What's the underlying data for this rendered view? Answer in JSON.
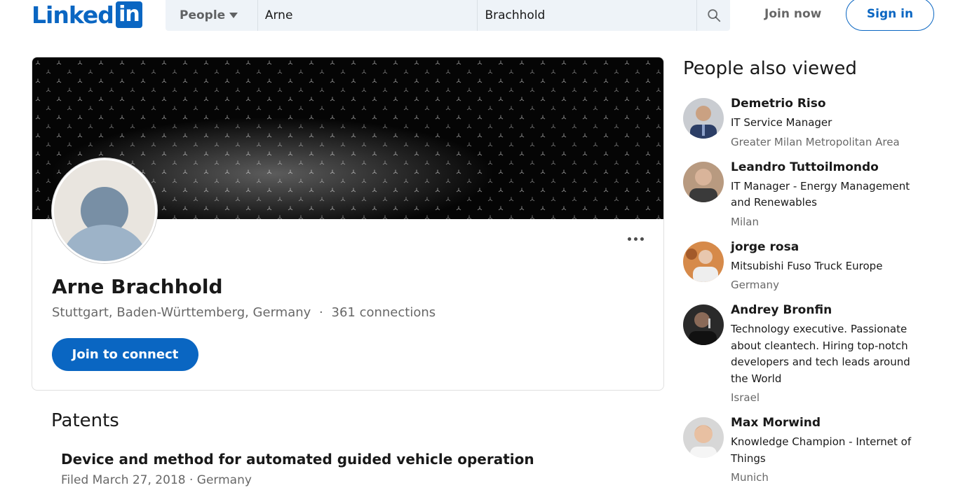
{
  "header": {
    "logo_text": "Linked",
    "logo_box_text": "in",
    "search_type_label": "People",
    "first_name_value": "Arne",
    "last_name_value": "Brachhold",
    "join_now_label": "Join now",
    "sign_in_label": "Sign in",
    "search_icon": "search-icon"
  },
  "profile": {
    "name": "Arne Brachhold",
    "location": "Stuttgart, Baden-Württemberg, Germany",
    "separator": "·",
    "connections": "361 connections",
    "join_to_connect_label": "Join to connect",
    "more_icon": "more-icon"
  },
  "patents": {
    "heading": "Patents",
    "items": [
      {
        "title": "Device and method for automated guided vehicle operation",
        "meta": "Filed March 27, 2018 · Germany"
      }
    ]
  },
  "people_also_viewed": {
    "heading": "People also viewed",
    "people": [
      {
        "name": "Demetrio Riso",
        "headline": "IT Service Manager",
        "location": "Greater Milan Metropolitan Area"
      },
      {
        "name": "Leandro Tuttoilmondo",
        "headline": "IT Manager - Energy Management and Renewables",
        "location": "Milan"
      },
      {
        "name": "jorge rosa",
        "headline": "Mitsubishi Fuso Truck Europe",
        "location": "Germany"
      },
      {
        "name": "Andrey Bronfin",
        "headline": "Technology executive. Passionate about cleantech. Hiring top-notch developers and tech leads around the World",
        "location": "Israel"
      },
      {
        "name": "Max Morwind",
        "headline": "Knowledge Champion - Internet of Things",
        "location": "Munich"
      }
    ]
  },
  "colors": {
    "brand": "#0a66c2",
    "search_bg": "#eef3f8",
    "cover_bg": "#050505"
  }
}
